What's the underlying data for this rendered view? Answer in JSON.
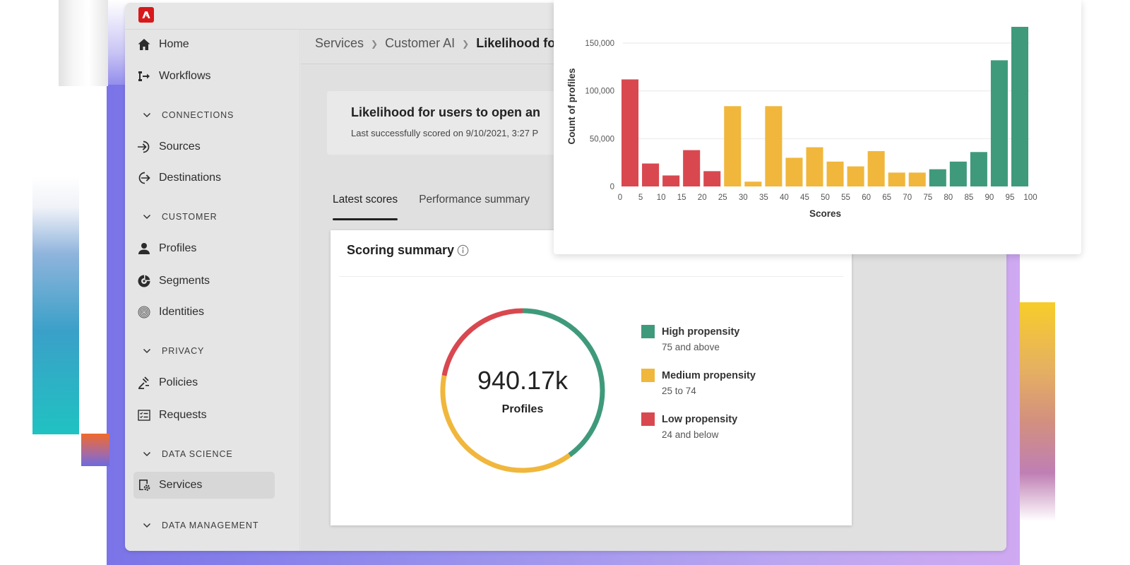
{
  "app": {
    "logo_label": "Adobe"
  },
  "sidebar": {
    "items": [
      {
        "type": "item",
        "label": "Home",
        "icon": "home-icon"
      },
      {
        "type": "item",
        "label": "Workflows",
        "icon": "workflows-icon"
      },
      {
        "type": "section",
        "label": "CONNECTIONS"
      },
      {
        "type": "item",
        "label": "Sources",
        "icon": "sources-icon"
      },
      {
        "type": "item",
        "label": "Destinations",
        "icon": "destinations-icon"
      },
      {
        "type": "section",
        "label": "CUSTOMER"
      },
      {
        "type": "item",
        "label": "Profiles",
        "icon": "profile-icon"
      },
      {
        "type": "item",
        "label": "Segments",
        "icon": "segments-icon"
      },
      {
        "type": "item",
        "label": "Identities",
        "icon": "fingerprint-icon"
      },
      {
        "type": "section",
        "label": "PRIVACY"
      },
      {
        "type": "item",
        "label": "Policies",
        "icon": "gavel-icon"
      },
      {
        "type": "item",
        "label": "Requests",
        "icon": "checklist-icon"
      },
      {
        "type": "section",
        "label": "DATA SCIENCE"
      },
      {
        "type": "item",
        "label": "Services",
        "icon": "services-gear-icon",
        "active": true
      },
      {
        "type": "section",
        "label": "DATA MANAGEMENT"
      }
    ]
  },
  "breadcrumb": {
    "items": [
      "Services",
      "Customer AI",
      "Likelihood fo"
    ]
  },
  "header": {
    "title": "Likelihood for users to open an",
    "subtitle": "Last successfully scored on 9/10/2021, 3:27 P"
  },
  "tabs": [
    {
      "label": "Latest scores",
      "active": true
    },
    {
      "label": "Performance summary",
      "active": false
    }
  ],
  "scoring_summary": {
    "title": "Scoring summary",
    "total_value": "940.17k",
    "total_label": "Profiles",
    "segments": [
      {
        "name": "High propensity",
        "range": "75 and above",
        "color": "#3f9a7b",
        "share": 0.4
      },
      {
        "name": "Medium propensity",
        "range": "25 to 74",
        "color": "#f0b73c",
        "share": 0.38
      },
      {
        "name": "Low propensity",
        "range": "24 and below",
        "color": "#d9484f",
        "share": 0.22
      }
    ]
  },
  "chart_data": {
    "type": "bar",
    "title": "",
    "xlabel": "Scores",
    "ylabel": "Count of profiles",
    "ylim": [
      0,
      150000
    ],
    "y_ticks": [
      0,
      50000,
      100000,
      150000
    ],
    "y_tick_labels": [
      "0",
      "50,000",
      "100,000",
      "150,000"
    ],
    "x_tick_labels": [
      "0",
      "5",
      "10",
      "15",
      "20",
      "25",
      "30",
      "35",
      "40",
      "45",
      "50",
      "55",
      "60",
      "65",
      "70",
      "75",
      "80",
      "85",
      "90",
      "95",
      "100"
    ],
    "grid": true,
    "categories": [
      "0-5",
      "5-10",
      "10-15",
      "15-20",
      "20-25",
      "25-30",
      "30-35",
      "35-40",
      "40-45",
      "45-50",
      "50-55",
      "55-60",
      "60-65",
      "65-70",
      "70-75",
      "75-80",
      "80-85",
      "85-90",
      "90-95",
      "95-100"
    ],
    "values": [
      112000,
      24000,
      11500,
      38000,
      16000,
      84000,
      5000,
      84000,
      30000,
      41000,
      26000,
      21000,
      37000,
      14500,
      14500,
      18000,
      26000,
      36000,
      132000,
      167000
    ],
    "bar_colors": {
      "low": "#d9484f",
      "medium": "#f0b73c",
      "high": "#3f9a7b"
    },
    "color_bands": [
      "low",
      "low",
      "low",
      "low",
      "low",
      "medium",
      "medium",
      "medium",
      "medium",
      "medium",
      "medium",
      "medium",
      "medium",
      "medium",
      "medium",
      "high",
      "high",
      "high",
      "high",
      "high"
    ]
  }
}
